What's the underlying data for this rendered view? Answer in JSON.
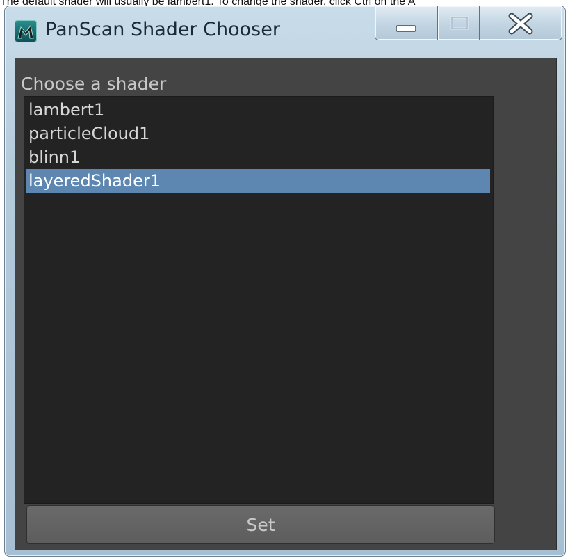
{
  "caption": "The default shader will usually be lambert1. To change the shader, click Ctrl on the A",
  "window": {
    "title": "PanScan Shader Chooser",
    "controls": [
      "minimize-icon",
      "maximize-icon",
      "close-icon"
    ]
  },
  "main": {
    "label": "Choose a shader",
    "shaders": [
      {
        "label": "lambert1",
        "selected": false
      },
      {
        "label": "particleCloud1",
        "selected": false
      },
      {
        "label": "blinn1",
        "selected": false
      },
      {
        "label": "layeredShader1",
        "selected": true
      }
    ],
    "set_label": "Set"
  },
  "colors": {
    "panel": "#444444",
    "list_bg": "#232323",
    "selection": "#5d86b0"
  }
}
